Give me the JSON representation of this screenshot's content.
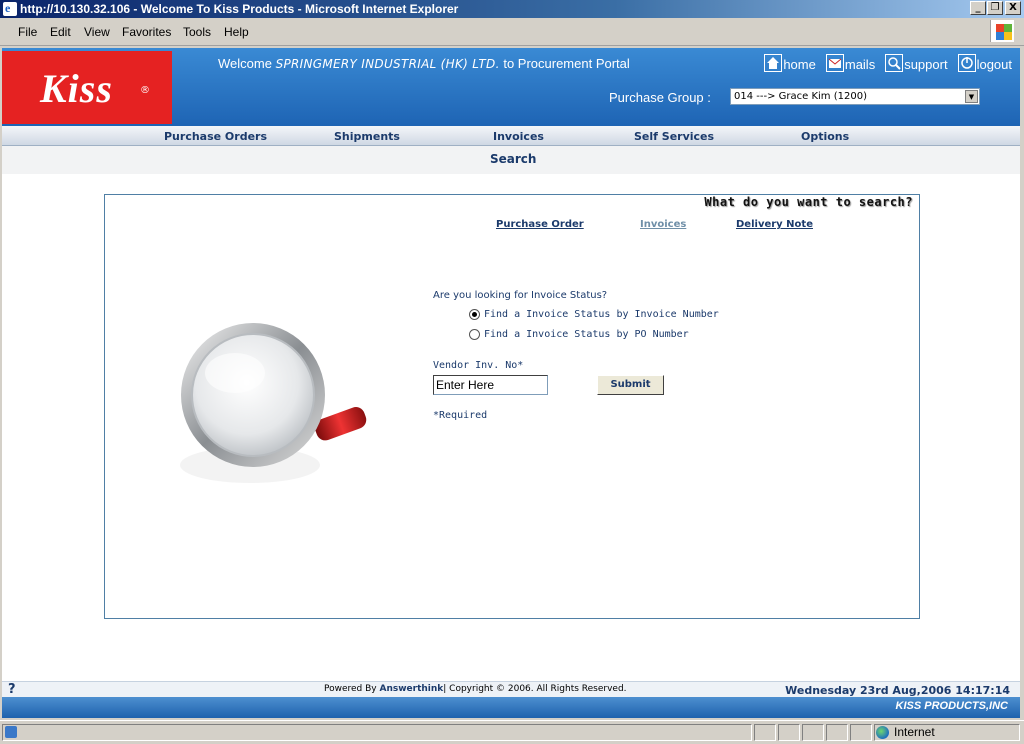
{
  "window": {
    "title": "http://10.130.32.106 - Welcome To Kiss Products - Microsoft Internet Explorer",
    "minimize": "_",
    "maximize": "❐",
    "close": "X"
  },
  "menu": [
    "File",
    "Edit",
    "View",
    "Favorites",
    "Tools",
    "Help"
  ],
  "header": {
    "logo_text": "Kiss",
    "logo_mark": "®",
    "welcome_prefix": "Welcome",
    "company": "SPRINGMERY INDUSTRIAL (HK) LTD.",
    "welcome_suffix": "to Procurement Portal",
    "links": [
      {
        "label": "home",
        "icon": "home-icon"
      },
      {
        "label": "mails",
        "icon": "mail-icon"
      },
      {
        "label": "support",
        "icon": "support-icon"
      },
      {
        "label": "logout",
        "icon": "logout-icon"
      }
    ],
    "purchase_group_label": "Purchase Group :",
    "purchase_group_value": "014 ---> Grace Kim (1200)"
  },
  "nav": [
    "Purchase Orders",
    "Shipments",
    "Invoices",
    "Self Services",
    "Options"
  ],
  "subbar_title": "Search",
  "search": {
    "question": "What do you want to search?",
    "tabs": [
      "Purchase Order",
      "Invoices",
      "Delivery Note"
    ],
    "active_tab": "Invoices",
    "form_question": "Are you looking for Invoice Status?",
    "options": [
      {
        "label": "Find a Invoice Status by Invoice Number",
        "selected": true
      },
      {
        "label": "Find a Invoice Status by PO Number",
        "selected": false
      }
    ],
    "field_label": "Vendor Inv. No*",
    "field_value": "Enter Here",
    "submit_label": "Submit",
    "required_note": "*Required"
  },
  "footer": {
    "help": "?",
    "powered_prefix": "Powered By",
    "powered_by": "Answerthink",
    "copyright": "| Copyright © 2006. All Rights Reserved.",
    "datetime": "Wednesday 23rd Aug,2006 14:17:14",
    "brand": "KISS PRODUCTS,INC"
  },
  "status": {
    "zone": "Internet"
  }
}
